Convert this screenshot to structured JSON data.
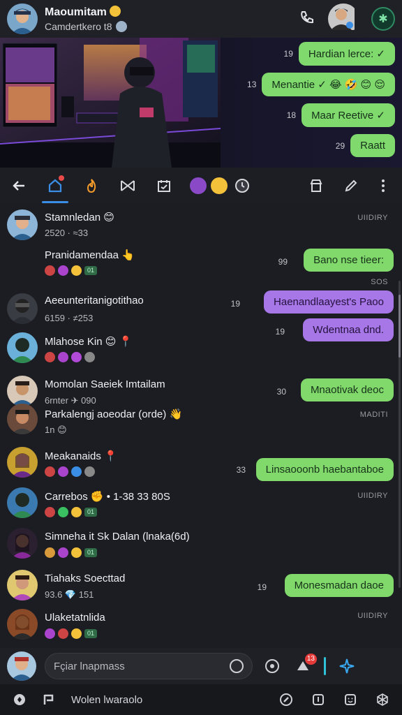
{
  "header": {
    "name": "Maoumitam",
    "subtitle": "Camdertkero t8",
    "name_emoji": "smile-emoji",
    "globe_icon": "globe-icon",
    "call_icon": "phone-icon",
    "action_icon": "refresh-icon"
  },
  "hero": {
    "image_desc": "gaming-setup-image",
    "bubbles": [
      {
        "time": "19",
        "text": "Hardian lerce: ✓"
      },
      {
        "time": "13",
        "text": "Menantie ✓ 😂 🤣 😊 😌"
      },
      {
        "time": "18",
        "text": "Maar Reetive ✓"
      },
      {
        "time": "29",
        "text": "Raatt"
      }
    ]
  },
  "actionbar": {
    "back_icon": "arrow-left-icon",
    "icons": [
      "home-icon",
      "fire-icon",
      "bowtie-icon",
      "calendar-icon",
      "emoji-purple",
      "emoji-yellow",
      "clock-icon",
      "store-icon",
      "edit-icon",
      "more-vertical-icon"
    ]
  },
  "chats": [
    {
      "name": "Stamnledan 😊",
      "meta": "2520  ·  ≈33",
      "right": "UIIDIRY"
    },
    {
      "name": "Pranidamendaa 👆",
      "meta": "",
      "time": "99",
      "bubble": "Bano nse tieer:",
      "bubble_color": "green"
    },
    {
      "name": "Aeeunteritanigotithao",
      "meta": "6159  ·  ≠253",
      "time": "19",
      "bubble": "Haenandlaayest's Paoo",
      "bubble_color": "purple"
    },
    {
      "name": "Mlahose Kin 😊 📍",
      "meta": "",
      "time": "19",
      "bubble": "Wdentnaa dnd.",
      "bubble_color": "purple"
    },
    {
      "name": "Momolan Saeiek Imtailam",
      "meta": "6rnter  ✈ 090",
      "time": "30",
      "bubble": "Mnaotivak deoc",
      "bubble_color": "green"
    },
    {
      "name": "Parkalengj aoeodar (orde) 👋",
      "meta": "1n 😊",
      "right": "MADITI"
    },
    {
      "name": "Meakanaids 📍",
      "meta": ""
    },
    {
      "name": "",
      "time": "33",
      "bubble": "Linsaooonb haebantaboe",
      "bubble_color": "green"
    },
    {
      "name": "Carrebos ✊  •  1-38 33 80S",
      "meta": "",
      "right": "UIIDIRY"
    },
    {
      "name": "Simneha it Sk Dalan (lnaka(6d)",
      "meta": ""
    },
    {
      "name": "Tiahaks Soecttad",
      "meta": "93.6  💎 151",
      "time": "19",
      "bubble": "Monesmadan daoe",
      "bubble_color": "green"
    },
    {
      "name": "Ulaketatnlida",
      "meta": "",
      "right": "UIIDIRY"
    }
  ],
  "small_label": "SOS",
  "composer": {
    "placeholder": "Fçiar lnapmass",
    "badge_count": "13"
  },
  "bottomnav": {
    "label": "Wolen lwaraolo"
  }
}
